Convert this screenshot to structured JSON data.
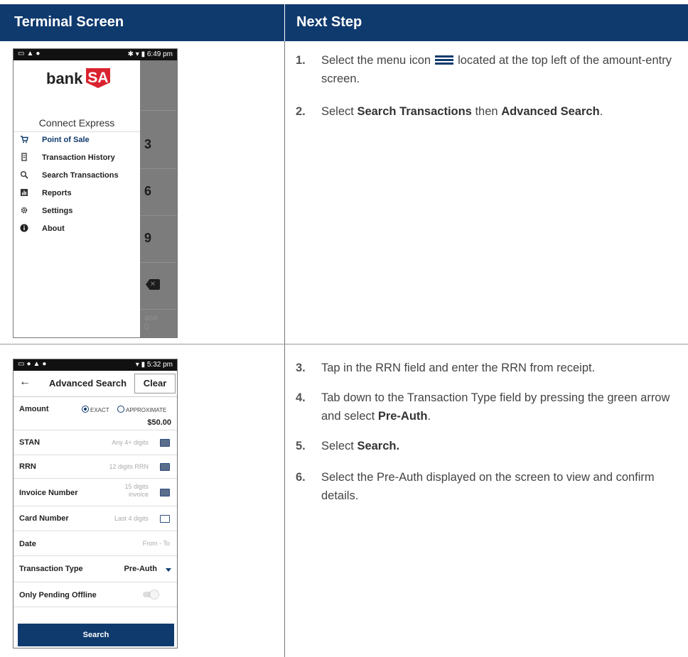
{
  "header": {
    "col1": "Terminal Screen",
    "col2": "Next Step"
  },
  "screen1": {
    "status_time": "6:49 pm",
    "brand_prefix": "bank",
    "brand_suffix": "SA",
    "app_name": "Connect Express",
    "menu": [
      {
        "icon": "cart-icon",
        "label": "Point of Sale",
        "selected": true
      },
      {
        "icon": "receipt-icon",
        "label": "Transaction History"
      },
      {
        "icon": "search-icon",
        "label": "Search Transactions"
      },
      {
        "icon": "chart-icon",
        "label": "Reports"
      },
      {
        "icon": "gear-icon",
        "label": "Settings"
      },
      {
        "icon": "info-icon",
        "label": "About"
      }
    ],
    "keys": [
      "3",
      "6",
      "9"
    ],
    "faint_text_1": "ase",
    "faint_text_2": "0"
  },
  "screen2": {
    "status_time": "5:32 pm",
    "title": "Advanced Search",
    "clear_label": "Clear",
    "amount": {
      "label": "Amount",
      "opt1": "EXACT",
      "opt2": "APPROXIMATE",
      "selected": "EXACT",
      "value": "$50.00"
    },
    "stan": {
      "label": "STAN",
      "placeholder": "Any 4+ digits"
    },
    "rrn": {
      "label": "RRN",
      "placeholder": "12 digits RRN"
    },
    "invoice": {
      "label": "Invoice Number",
      "placeholder_1": "15 digits",
      "placeholder_2": "invoice"
    },
    "card": {
      "label": "Card Number",
      "placeholder": "Last 4 digits"
    },
    "date": {
      "label": "Date",
      "placeholder": "From - To"
    },
    "txn_type": {
      "label": "Transaction Type",
      "value": "Pre-Auth"
    },
    "pending": {
      "label": "Only Pending Offline",
      "on": false
    },
    "search_label": "Search"
  },
  "steps": {
    "s1": {
      "num": "1.",
      "pre": "Select the menu icon",
      "post": "located at the top left of the amount-entry screen."
    },
    "s2": {
      "num": "2.",
      "pre": "Select",
      "b1": "Search Transactions",
      "mid": "then",
      "b2": "Advanced Search",
      "post": "."
    },
    "s3": {
      "num": "3.",
      "text": "Tap in the RRN field and enter the RRN from receipt."
    },
    "s4": {
      "num": "4.",
      "pre": "Tab down to the Transaction Type field by pressing the green arrow and select",
      "b1": "Pre-Auth",
      "post": "."
    },
    "s5": {
      "num": "5.",
      "pre": "Select",
      "b1": "Search."
    },
    "s6": {
      "num": "6.",
      "text": "Select the Pre-Auth displayed on the screen to view and confirm details."
    }
  }
}
